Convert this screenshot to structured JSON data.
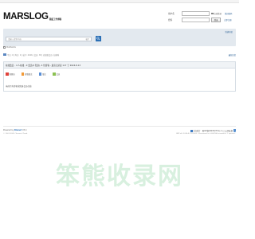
{
  "header": {
    "logo_main": "MARSLOG",
    "logo_sub": "我最工作博客"
  },
  "login": {
    "username_label": "用户名",
    "password_label": "密码",
    "remember_label": "自动登录",
    "forgot_label": "找回密码",
    "login_button": "登录",
    "register_link": "立即注册"
  },
  "nav": {
    "quick_nav": "快捷导航",
    "search_placeholder": "请输入搜索内容",
    "search_scope": "帖子"
  },
  "breadcrumb": {
    "site": "MARSLOG"
  },
  "stats": {
    "text": "今日: 0 | 昨日: 0 | 帖子: 2026 | 会员: 38 | 欢迎新会员: 在家睡",
    "right_link": "最新回复"
  },
  "panel": {
    "title": "在线会员 - 4 人在线 - 0 会员(0 隐身), 4 位游客 - 最高记录是 117 于 2024-8-13",
    "legend": [
      {
        "label": "管理员",
        "color": "#e0413a"
      },
      {
        "label": "超级版主",
        "color": "#f29a37"
      },
      {
        "label": "版主",
        "color": "#5a8fd6"
      },
      {
        "label": "会员",
        "color": "#8cc152"
      }
    ],
    "message": "当前只有游客或隐身会员在线"
  },
  "footer": {
    "powered_prefix": "Powered by",
    "powered_brand": "Discuz!",
    "version": "X3.4",
    "copyright": "© 2001-2020, Tencent Cloud.",
    "right_badge": "站长统计",
    "right_links": "蜀ICP备18033275号-1 | 川公网安备",
    "timezone": "GMT+8, 2024-9-13 03:03 , Processed in 0.030768 second(s), 7 queries ."
  },
  "watermark": {
    "text": "笨熊收录网"
  }
}
